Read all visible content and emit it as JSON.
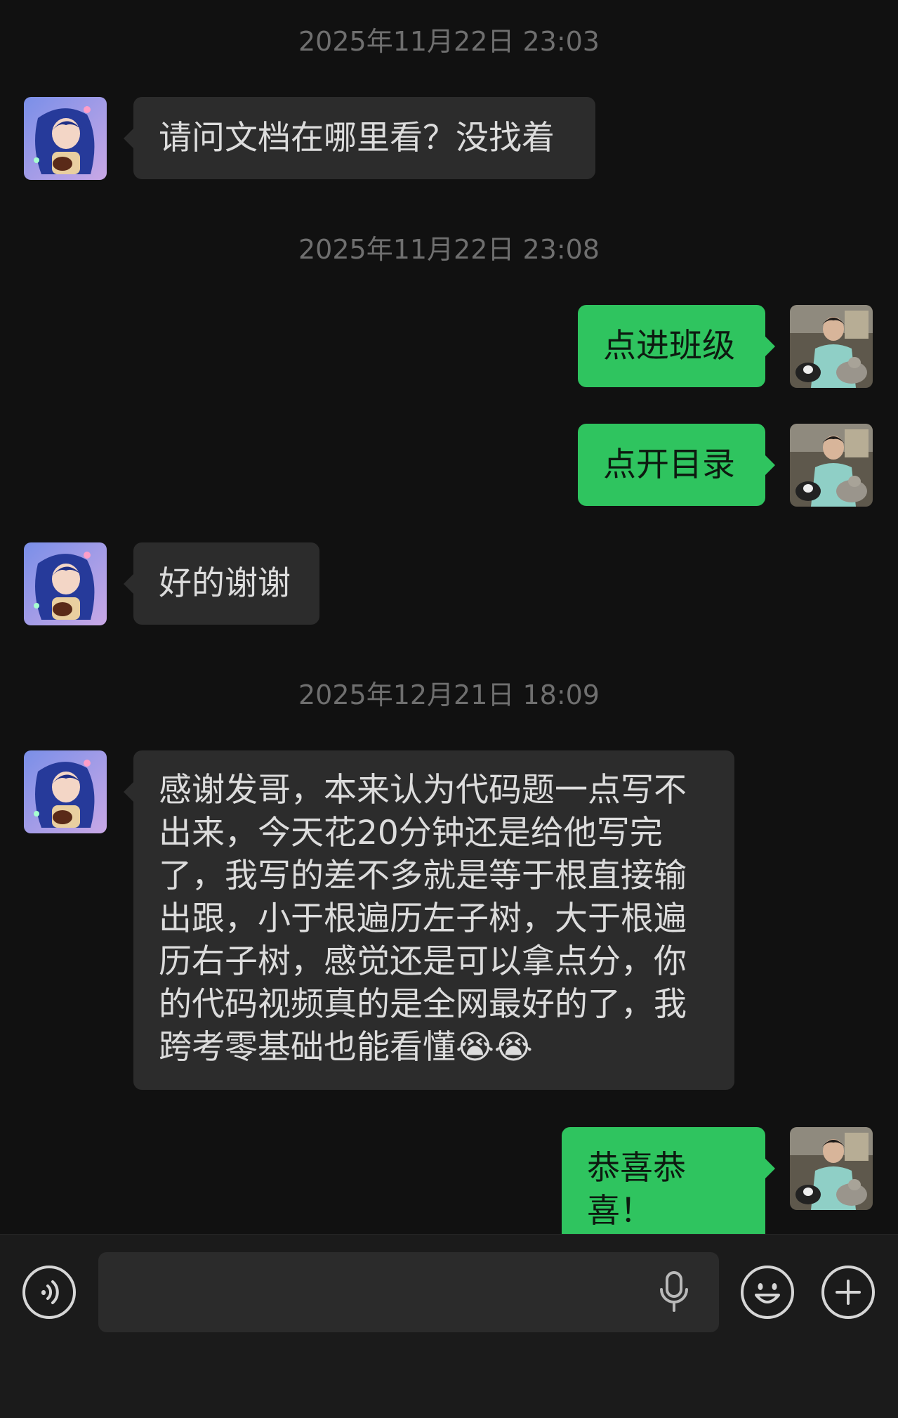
{
  "colors": {
    "background": "#111111",
    "incoming_bubble": "#2c2c2c",
    "outgoing_bubble": "#2fc45f",
    "timestamp": "#6f6f6f",
    "input_bar": "#1b1b1b"
  },
  "messages": {
    "ts1": "2025年11月22日 23:03",
    "m1": "请问文档在哪里看？没找着",
    "ts2": "2025年11月22日 23:08",
    "m2": "点进班级",
    "m3": "点开目录",
    "m4": "好的谢谢",
    "ts3": "2025年12月21日 18:09",
    "m5": "感谢发哥，本来认为代码题一点写不出来，今天花20分钟还是给他写完了，我写的差不多就是等于根直接输出跟，小于根遍历左子树，大于根遍历右子树，感觉还是可以拿点分，你的代码视频真的是全网最好的了，我跨考零基础也能看懂😭😭",
    "m6": "恭喜恭喜！"
  },
  "input_bar": {
    "placeholder": "",
    "icons": [
      "voice-icon",
      "microphone-icon",
      "emoji-icon",
      "plus-icon"
    ]
  }
}
